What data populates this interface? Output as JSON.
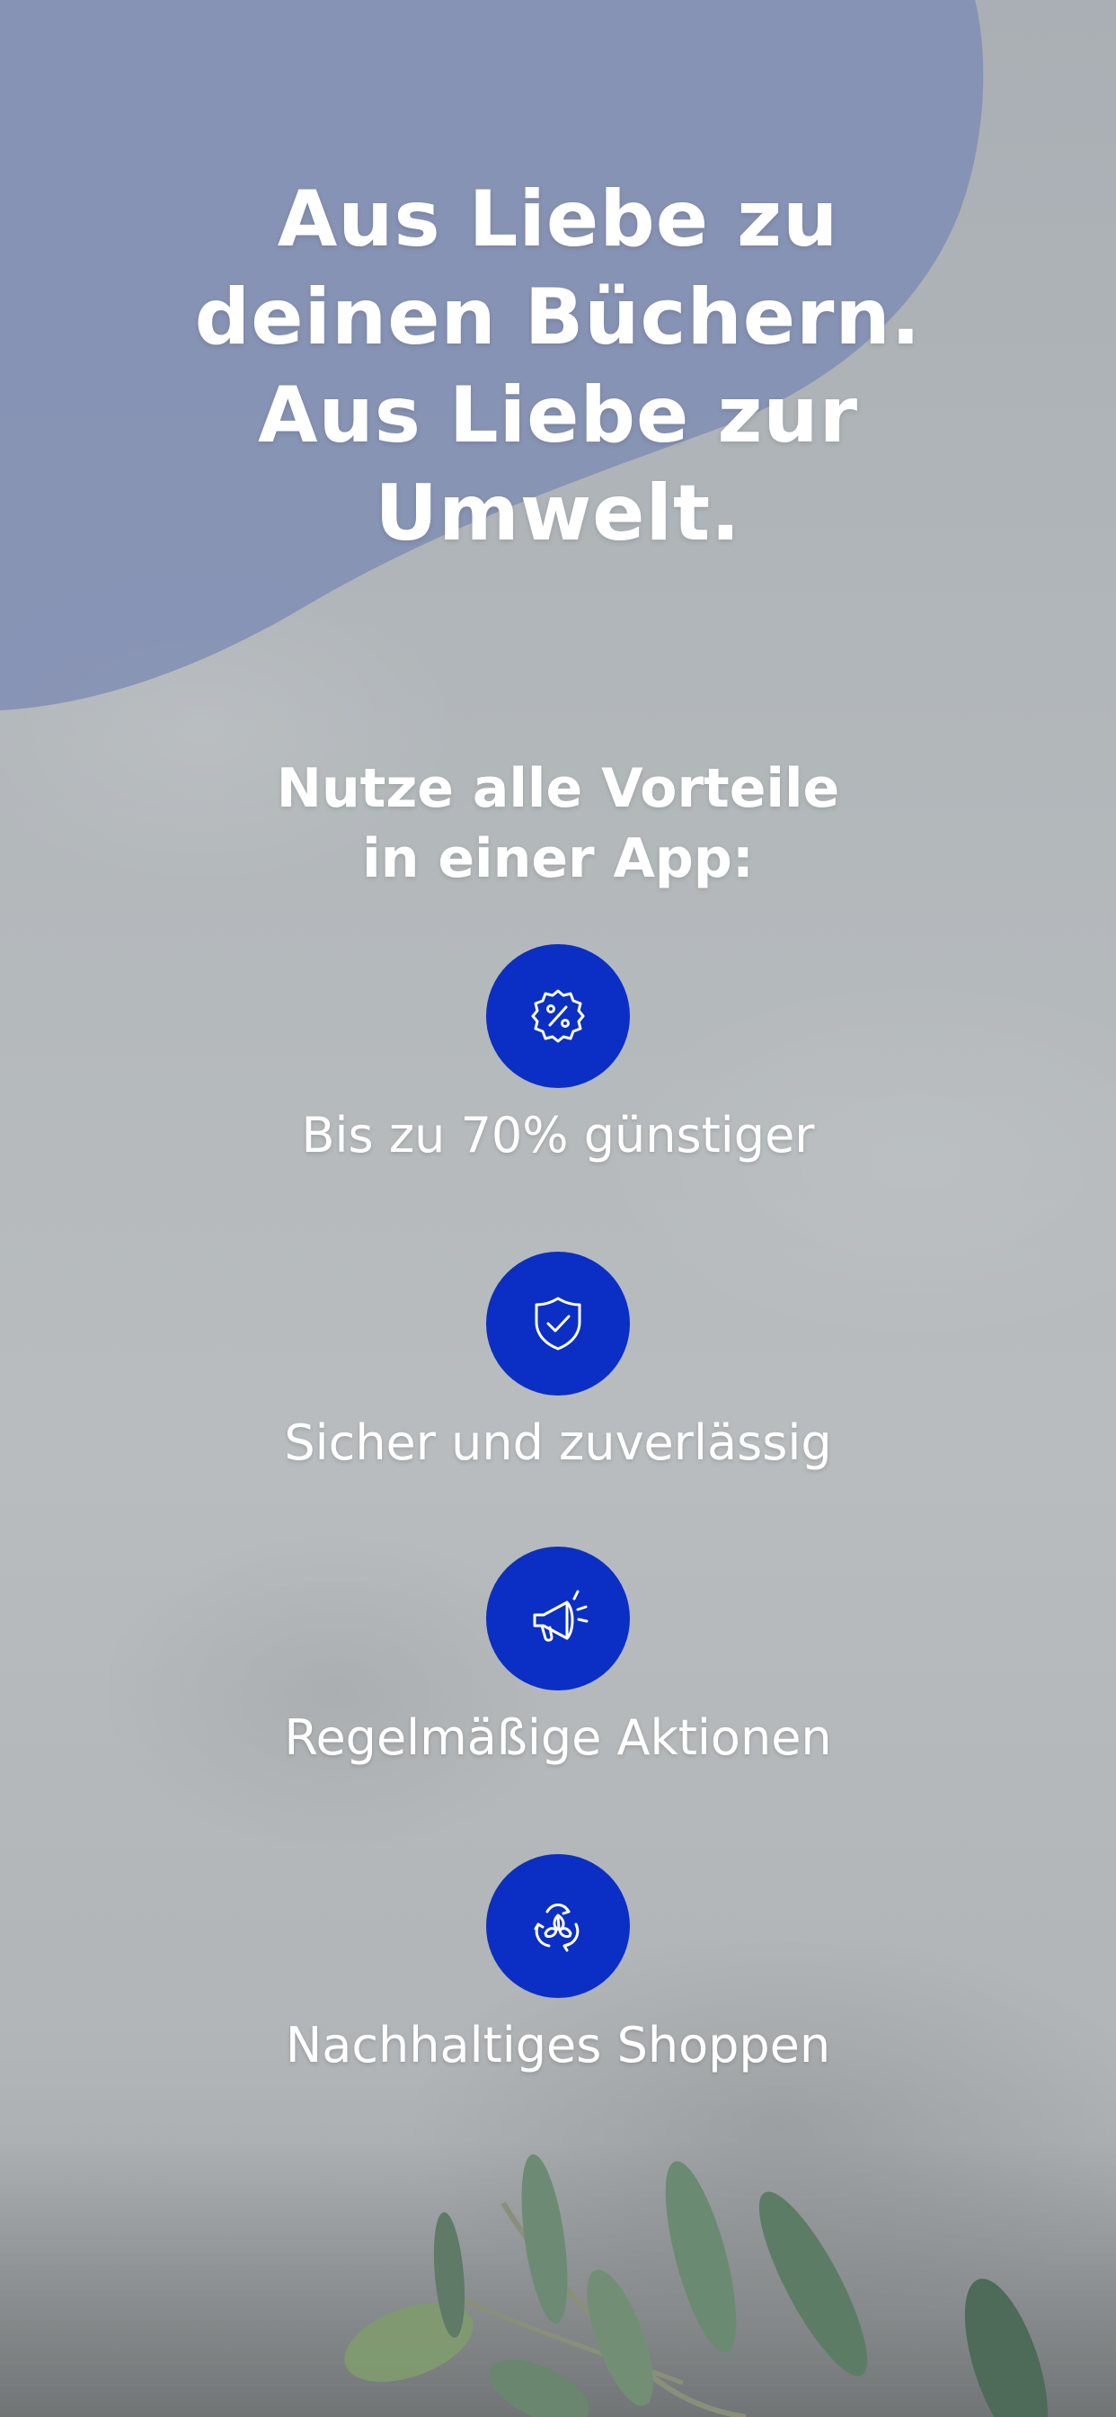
{
  "headline": "Aus Liebe zu\ndeinen Büchern.\nAus Liebe zur\nUmwelt.",
  "subheadline": "Nutze alle Vorteile\nin einer App:",
  "features": [
    {
      "icon": "percent-badge-icon",
      "label": "Bis zu 70% günstiger"
    },
    {
      "icon": "shield-check-icon",
      "label": "Sicher und zuverlässig"
    },
    {
      "icon": "megaphone-icon",
      "label": "Regelmäßige Aktionen"
    },
    {
      "icon": "recycle-leaves-icon",
      "label": "Nachhaltiges Shoppen"
    }
  ],
  "colors": {
    "accent": "#0b2fc4",
    "blob": "#7f8cb3",
    "text": "#ffffff",
    "background": "#b3b8bb",
    "leaf": "#6f8f76"
  }
}
